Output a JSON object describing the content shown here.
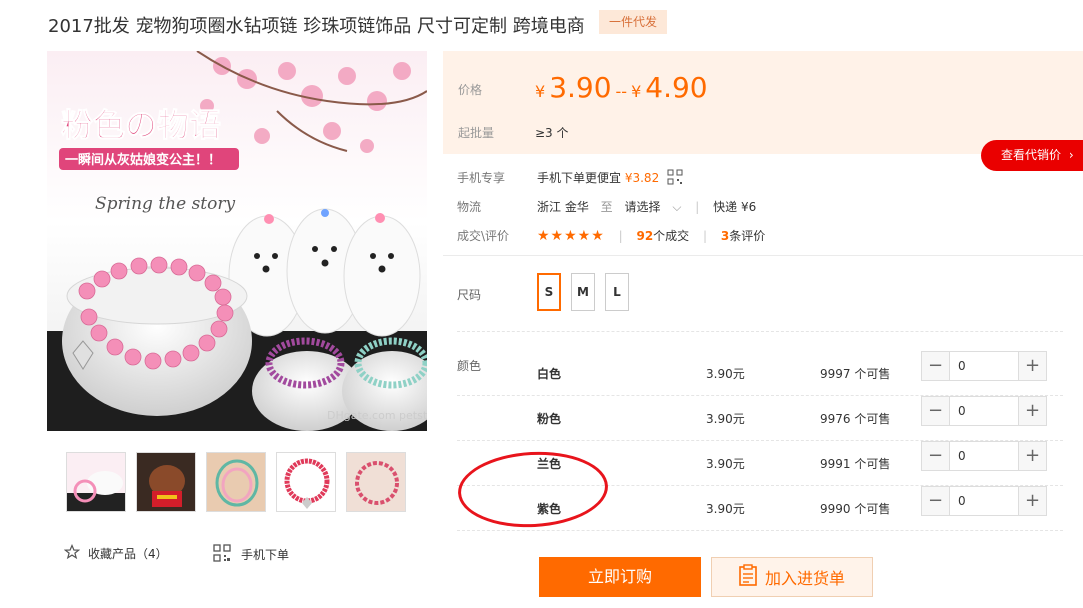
{
  "product": {
    "title": "2017批发 宠物狗项圈水钻项链 珍珠项链饰品 尺寸可定制 跨境电商",
    "tag": "一件代发"
  },
  "gallery": {
    "main_image": {
      "headline": "粉色の物语",
      "subline": "一瞬间从灰姑娘变公主！！",
      "spring_text": "Spring the story",
      "watermark": "DHgate.com petstore"
    },
    "thumbnails": [
      "thumb-1",
      "thumb-2",
      "thumb-3",
      "thumb-4",
      "thumb-5"
    ]
  },
  "actions_left": {
    "favorite": "收藏产品（4）",
    "mobile_order": "手机下单"
  },
  "price": {
    "label": "价格",
    "currency": "¥",
    "min": "3.90",
    "dash": "--",
    "max": "4.90",
    "batch_label": "起批量",
    "batch_value": "≥3 个"
  },
  "agent_button": "查看代销价",
  "mobile_exclusive": {
    "label": "手机专享",
    "text": "手机下单更便宜",
    "price": "¥3.82"
  },
  "logistics": {
    "label": "物流",
    "origin": "浙江 金华",
    "to": "至",
    "select": "请选择",
    "express": "快递 ¥6"
  },
  "reviews": {
    "label": "成交\\评价",
    "stars": "★★★★★",
    "deals_count": "92",
    "deals_text": "个成交",
    "review_count": "3",
    "review_text": "条评价"
  },
  "sizes": {
    "label": "尺码",
    "options": [
      "S",
      "M",
      "L"
    ],
    "selected": "S"
  },
  "colors": {
    "label": "颜色",
    "rows": [
      {
        "name": "白色",
        "price": "3.90元",
        "stock": "9997 个可售",
        "qty": "0"
      },
      {
        "name": "粉色",
        "price": "3.90元",
        "stock": "9976 个可售",
        "qty": "0"
      },
      {
        "name": "兰色",
        "price": "3.90元",
        "stock": "9991 个可售",
        "qty": "0"
      },
      {
        "name": "紫色",
        "price": "3.90元",
        "stock": "9990 个可售",
        "qty": "0"
      }
    ]
  },
  "buttons": {
    "buy": "立即订购",
    "cart": "加入进货单"
  },
  "colors_theme": {
    "accent": "#ff6a00",
    "agent_red": "#ea0000",
    "price_bg": "#fff2e8",
    "annotation_red": "#e8141c"
  }
}
